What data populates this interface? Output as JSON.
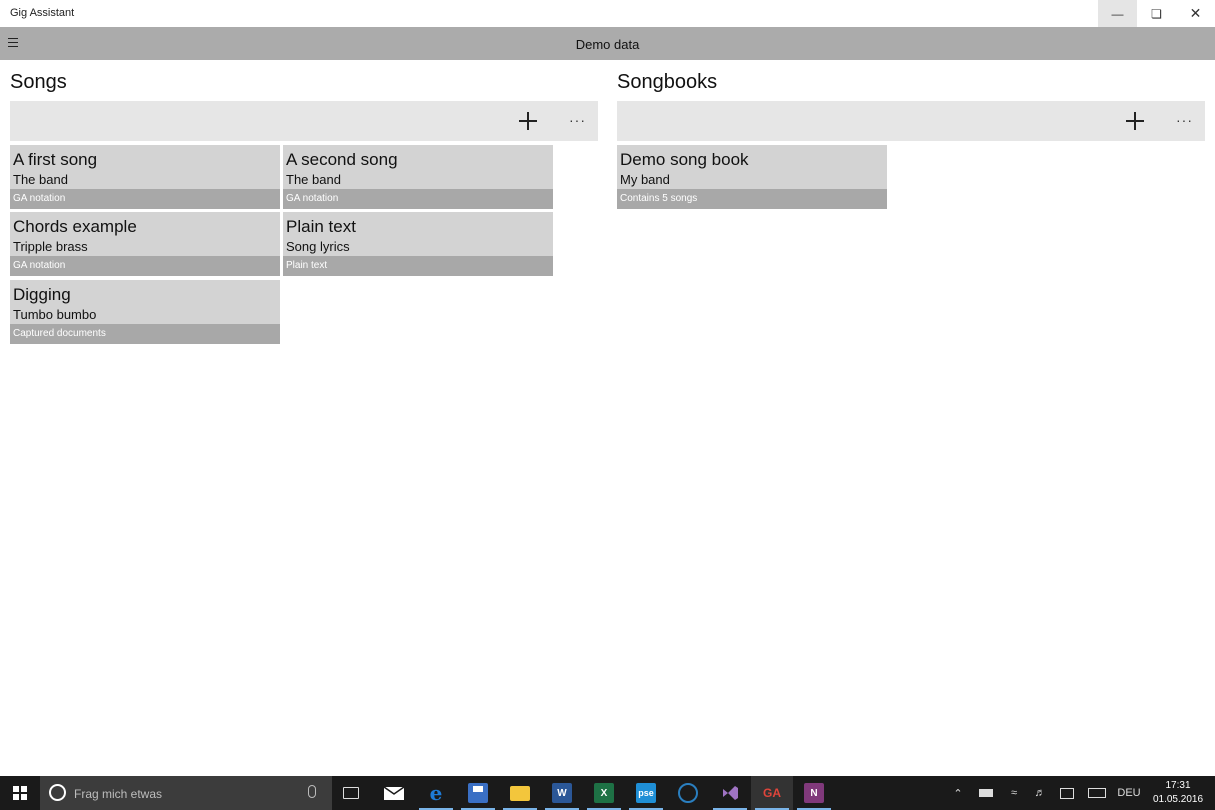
{
  "window": {
    "title": "Gig Assistant"
  },
  "commandbar": {
    "title": "Demo data"
  },
  "songs": {
    "heading": "Songs",
    "more_label": "···",
    "items": [
      {
        "title": "A first song",
        "artist": "The band",
        "type": "GA notation"
      },
      {
        "title": "A second song",
        "artist": "The band",
        "type": "GA notation"
      },
      {
        "title": "Chords example",
        "artist": "Tripple brass",
        "type": "GA notation"
      },
      {
        "title": "Plain text",
        "artist": "Song lyrics",
        "type": "Plain text"
      },
      {
        "title": "Digging",
        "artist": "Tumbo bumbo",
        "type": "Captured documents"
      }
    ]
  },
  "songbooks": {
    "heading": "Songbooks",
    "more_label": "···",
    "items": [
      {
        "title": "Demo song book",
        "artist": "My band",
        "info": "Contains 5 songs"
      }
    ]
  },
  "taskbar": {
    "search_placeholder": "Frag mich etwas",
    "language": "DEU",
    "time": "17:31",
    "date": "01.05.2016",
    "apps": [
      {
        "icon": "task-view-icon"
      },
      {
        "icon": "mail-icon"
      },
      {
        "icon": "edge-icon",
        "color": "#1e7bd6"
      },
      {
        "icon": "save-disk-icon",
        "color": "#3a6fc4"
      },
      {
        "icon": "file-explorer-icon",
        "color": "#f3c63c"
      },
      {
        "icon": "word-icon",
        "color": "#2b5797",
        "label": "W"
      },
      {
        "icon": "excel-icon",
        "color": "#1e7145",
        "label": "X"
      },
      {
        "icon": "pse-icon",
        "color": "#1f8fd6",
        "label": "pse"
      },
      {
        "icon": "browser-icon",
        "color": "#2a7fc0"
      },
      {
        "icon": "visual-studio-icon",
        "color": "#68217a"
      },
      {
        "icon": "gig-assistant-icon",
        "color": "#c0392b",
        "label": "GA"
      },
      {
        "icon": "onenote-icon",
        "color": "#80397b",
        "label": "N"
      }
    ]
  },
  "colors": {
    "commandbar": "#ababab",
    "card": "#d3d3d3",
    "card_footer": "#a8a8a8",
    "toolbar": "#e6e6e6",
    "taskbar": "#1a1a1a"
  }
}
